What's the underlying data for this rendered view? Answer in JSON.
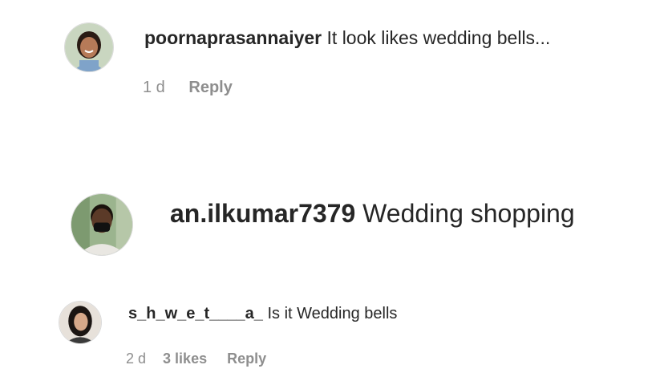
{
  "comments": [
    {
      "username": "poornaprasannaiyer",
      "text": "It look likes wedding bells...",
      "time": "1 d",
      "reply_label": "Reply",
      "avatar_icon": "profile-photo-woman-smiling",
      "avatar_colors": {
        "bg": "#c9d6c0",
        "skin": "#b67a58",
        "hair": "#2a1b14",
        "shirt": "#7fa3c9"
      }
    },
    {
      "username": "an.ilkumar7379",
      "text": "Wedding shopping",
      "avatar_icon": "profile-photo-man-masked",
      "avatar_colors": {
        "bg": "#9bb48e",
        "skin": "#5b3a28",
        "hair": "#1a120d",
        "shirt": "#e9e7e2"
      }
    },
    {
      "username": "s_h_w_e_t____a_",
      "text": "Is it Wedding bells",
      "time": "2 d",
      "likes": "3 likes",
      "reply_label": "Reply",
      "avatar_icon": "profile-photo-woman-dark-hair",
      "avatar_colors": {
        "bg": "#e7e1da",
        "skin": "#d7a98a",
        "hair": "#1b1512",
        "shirt": "#3a3a3a"
      }
    }
  ],
  "colors": {
    "text": "#262626",
    "meta": "#8e8e8e",
    "background": "#ffffff"
  }
}
